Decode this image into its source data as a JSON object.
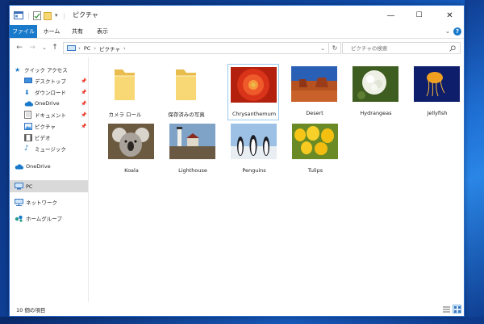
{
  "window": {
    "title": "ピクチャ"
  },
  "window_controls": {
    "minimize": "—",
    "maximize": "☐",
    "close": "✕"
  },
  "ribbon": {
    "tabs": [
      "ファイル",
      "ホーム",
      "共有",
      "表示"
    ],
    "expand_glyph": "⌄",
    "help_glyph": "?"
  },
  "address": {
    "back": "←",
    "forward": "→",
    "recent": "⌄",
    "up": "↑",
    "crumbs": [
      "PC",
      "ピクチャ"
    ],
    "separator": "›",
    "dropdown": "⌄",
    "refresh": "↻"
  },
  "search": {
    "placeholder": "ピクチャの検索"
  },
  "nav": {
    "quick_access": "クイック アクセス",
    "quick_items": [
      "デスクトップ",
      "ダウンロード",
      "OneDrive",
      "ドキュメント",
      "ピクチャ",
      "ビデオ",
      "ミュージック"
    ],
    "onedrive": "OneDrive",
    "pc": "PC",
    "network": "ネットワーク",
    "homegroup": "ホームグループ",
    "pin_glyph": "📌"
  },
  "items": [
    {
      "name": "カメラ ロール",
      "kind": "folder"
    },
    {
      "name": "保存済みの写真",
      "kind": "folder"
    },
    {
      "name": "Chrysanthemum",
      "kind": "image"
    },
    {
      "name": "Desert",
      "kind": "image"
    },
    {
      "name": "Hydrangeas",
      "kind": "image"
    },
    {
      "name": "Jellyfish",
      "kind": "image"
    },
    {
      "name": "Koala",
      "kind": "image"
    },
    {
      "name": "Lighthouse",
      "kind": "image"
    },
    {
      "name": "Penguins",
      "kind": "image"
    },
    {
      "name": "Tulips",
      "kind": "image"
    }
  ],
  "status": {
    "count": "10 個の項目"
  },
  "colors": {
    "accent": "#1979ca",
    "selection": "#99c9ef",
    "folder": "#f8d775"
  }
}
